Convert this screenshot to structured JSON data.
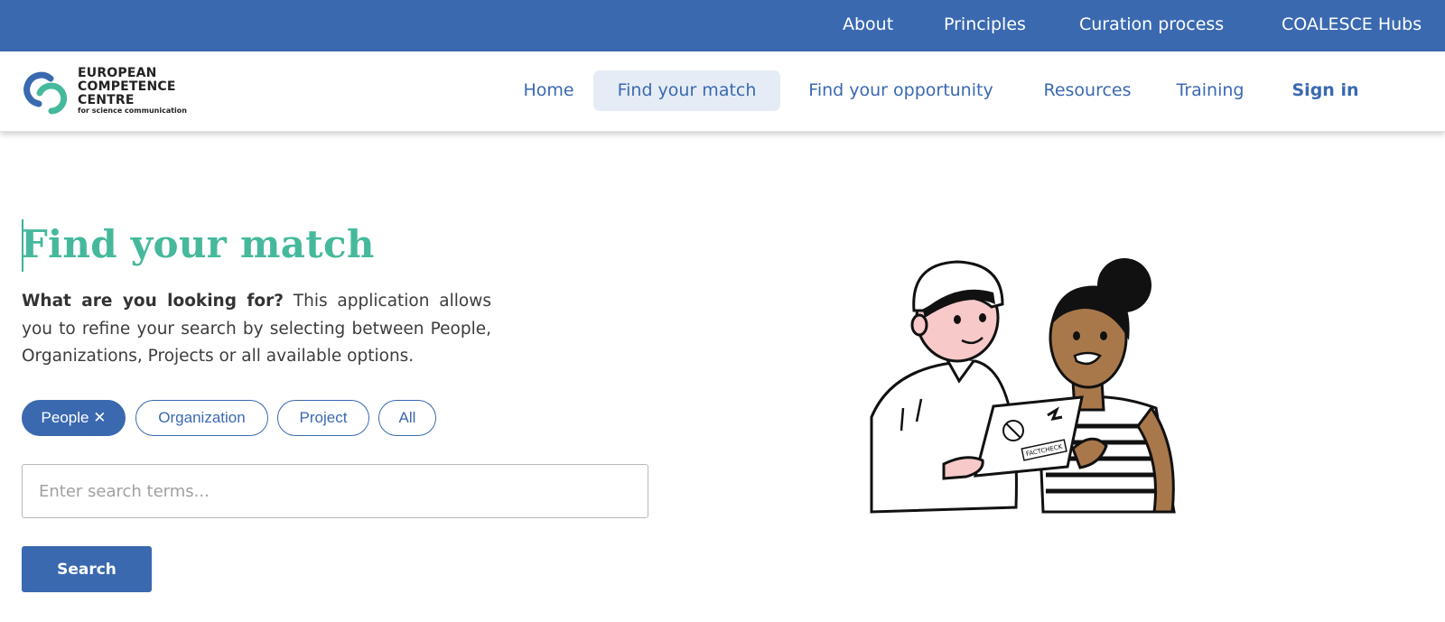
{
  "topbar": {
    "links": [
      "About",
      "Principles",
      "Curation process",
      "COALESCE Hubs"
    ]
  },
  "logo": {
    "line1": "EUROPEAN",
    "line2": "COMPETENCE",
    "line3": "CENTRE",
    "tagline": "for science communication"
  },
  "nav": {
    "home": "Home",
    "find_match": "Find your match",
    "find_opportunity": "Find your opportunity",
    "resources": "Resources",
    "training": "Training",
    "sign_in": "Sign in"
  },
  "main": {
    "title": "Find your match",
    "intro_bold": "What are you looking for?",
    "intro_rest": " This application allows you to refine your search by selecting between People, Organizations, Projects or all available options.",
    "filters": {
      "people": "People ✕",
      "organization": "Organization",
      "project": "Project",
      "all": "All"
    },
    "search": {
      "placeholder": "Enter search terms...",
      "button": "Search"
    },
    "laptop_sticker": "FACTCHECK"
  },
  "colors": {
    "brand_blue": "#3a69b0",
    "accent_green": "#46b99c"
  }
}
